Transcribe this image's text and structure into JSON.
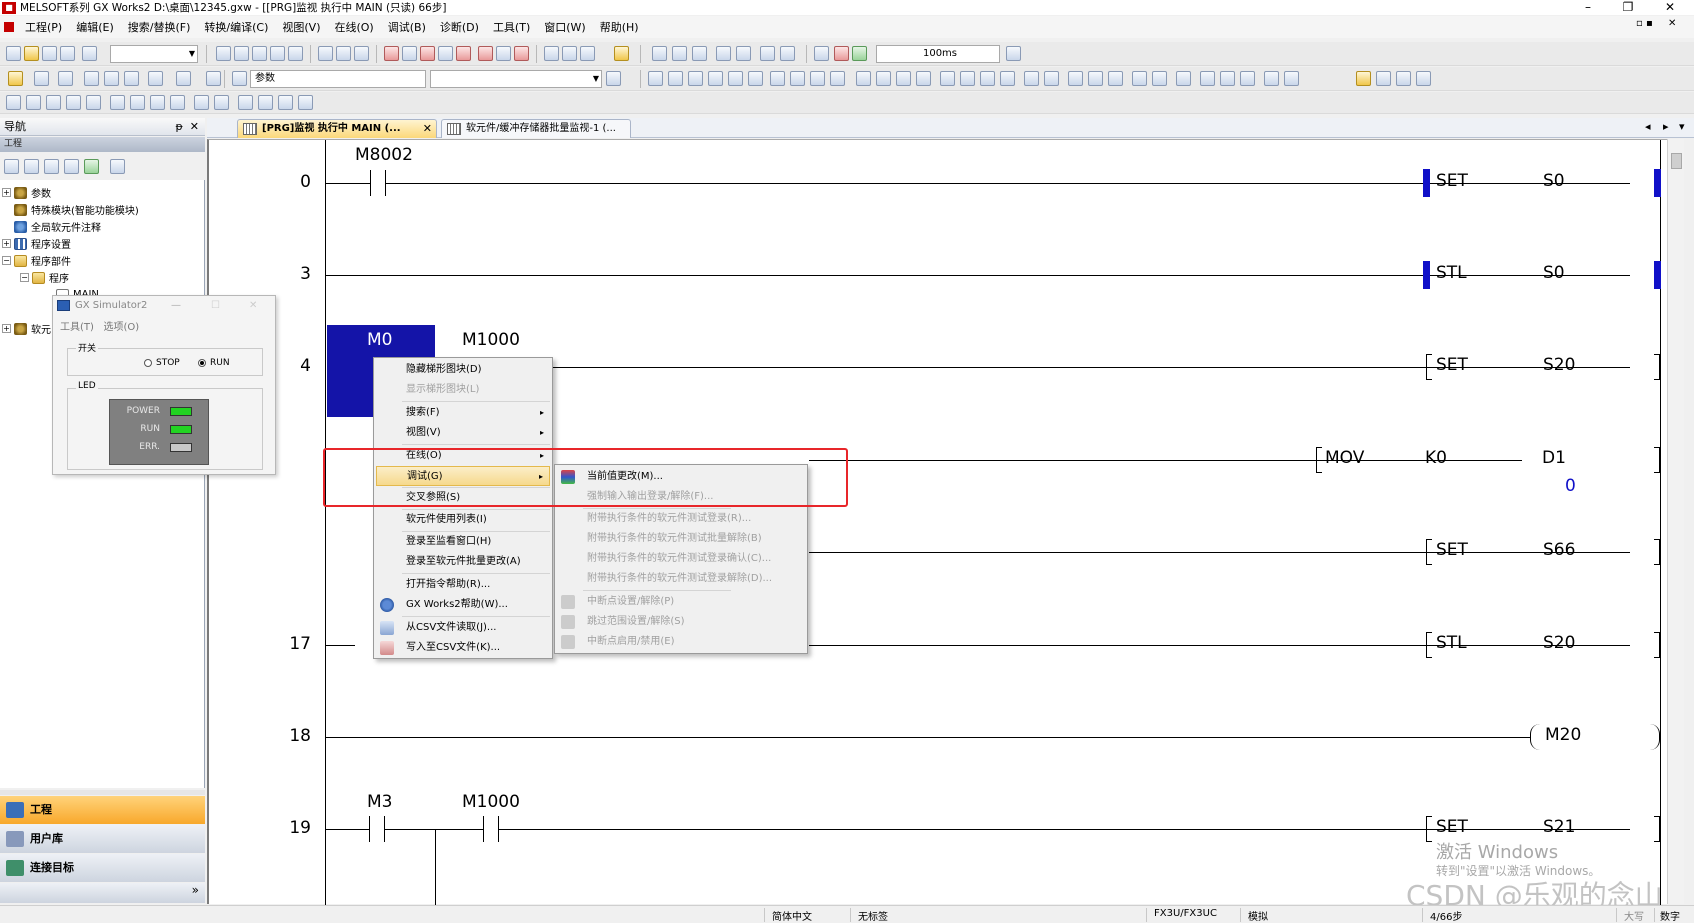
{
  "window": {
    "title": "MELSOFT系列 GX Works2 D:\\桌面\\12345.gxw - [[PRG]监视 执行中 MAIN (只读) 66步]",
    "minimize": "–",
    "restore": "❐",
    "close": "✕",
    "inner_restore": "▫ ▪",
    "inner_close": "✕"
  },
  "menubar": [
    "工程(P)",
    "编辑(E)",
    "搜索/替换(F)",
    "转换/编译(C)",
    "视图(V)",
    "在线(O)",
    "调试(B)",
    "诊断(D)",
    "工具(T)",
    "窗口(W)",
    "帮助(H)"
  ],
  "toolbar": {
    "scan_time": "100ms",
    "search_label": "参数"
  },
  "nav": {
    "title": "导航",
    "pin": "ᵽ",
    "close": "✕",
    "section": "工程",
    "tree": [
      {
        "label": "参数",
        "expander": "+"
      },
      {
        "label": "特殊模块(智能功能模块)",
        "expander": ""
      },
      {
        "label": "全局软元件注释",
        "expander": ""
      },
      {
        "label": "程序设置",
        "expander": "+"
      },
      {
        "label": "程序部件",
        "expander": "−"
      },
      {
        "label": "程序",
        "expander": "−"
      },
      {
        "label": "MAIN",
        "expander": ""
      },
      {
        "label": "软元",
        "expander": "+"
      }
    ],
    "buttons": [
      "工程",
      "用户库",
      "连接目标"
    ],
    "more": "»"
  },
  "simulator": {
    "title": "GX Simulator2",
    "min": "—",
    "max": "☐",
    "close": "✕",
    "menu": [
      "工具(T)",
      "选项(O)"
    ],
    "switch_group": "开关",
    "stop": "STOP",
    "run": "RUN",
    "led_group": "LED",
    "leds": [
      {
        "label": "POWER",
        "color": "#22d322"
      },
      {
        "label": "RUN",
        "color": "#22d322"
      },
      {
        "label": "ERR.",
        "color": "#c8c8c8"
      }
    ]
  },
  "tabs": [
    {
      "label": "[PRG]监视 执行中 MAIN (...",
      "close": "✕"
    },
    {
      "label": "软元件/缓冲存储器批量监视-1 (..."
    }
  ],
  "tab_nav": {
    "prev": "◂",
    "next": "▸",
    "menu": "▾"
  },
  "ladder": {
    "rungs": [
      {
        "step": "0",
        "contacts": [
          "M8002"
        ],
        "instr": "SET",
        "op": "S0"
      },
      {
        "step": "3",
        "contacts": [],
        "instr": "STL",
        "op": "S0"
      },
      {
        "step": "4",
        "contacts": [
          "M0",
          "M1000"
        ],
        "instr": "SET",
        "op": "S20"
      },
      {
        "step": "",
        "contacts": [],
        "instr": "MOV",
        "op1": "K0",
        "op2": "D1",
        "value": "0"
      },
      {
        "step": "",
        "contacts": [],
        "instr": "SET",
        "op": "S66"
      },
      {
        "step": "17",
        "contacts": [],
        "instr": "STL",
        "op": "S20"
      },
      {
        "step": "18",
        "contacts": [],
        "coil": "M20"
      },
      {
        "step": "19",
        "contacts": [
          "M3",
          "M1000"
        ],
        "instr": "SET",
        "op": "S21"
      }
    ]
  },
  "context_menu": {
    "items": [
      {
        "label": "隐藏梯形图块(D)",
        "disabled": false
      },
      {
        "label": "显示梯形图块(L)",
        "disabled": true
      },
      {
        "label": "搜索(F)",
        "submenu": true
      },
      {
        "label": "视图(V)",
        "submenu": true
      },
      {
        "label": "在线(O)",
        "submenu": true
      },
      {
        "label": "调试(G)",
        "submenu": true,
        "highlight": true
      },
      {
        "label": "交叉参照(S)"
      },
      {
        "label": "软元件使用列表(I)"
      },
      {
        "label": "登录至监看窗口(H)"
      },
      {
        "label": "登录至软元件批量更改(A)"
      },
      {
        "label": "打开指令帮助(R)..."
      },
      {
        "label": "GX Works2帮助(W)..."
      },
      {
        "label": "从CSV文件读取(J)..."
      },
      {
        "label": "写入至CSV文件(K)..."
      }
    ],
    "arrow": "▸"
  },
  "debug_submenu": [
    {
      "label": "当前值更改(M)...",
      "disabled": false
    },
    {
      "label": "强制输入输出登录/解除(F)...",
      "disabled": true
    },
    {
      "label": "附带执行条件的软元件测试登录(R)...",
      "disabled": true
    },
    {
      "label": "附带执行条件的软元件测试批量解除(B)",
      "disabled": true
    },
    {
      "label": "附带执行条件的软元件测试登录确认(C)...",
      "disabled": true
    },
    {
      "label": "附带执行条件的软元件测试登录解除(D)...",
      "disabled": true
    },
    {
      "label": "中断点设置/解除(P)",
      "disabled": true
    },
    {
      "label": "跳过范围设置/解除(S)",
      "disabled": true
    },
    {
      "label": "中断点启用/禁用(E)",
      "disabled": true
    }
  ],
  "status": {
    "lang": "简体中文",
    "title": "无标签",
    "plc": "FX3U/FX3UC",
    "mode": "模拟",
    "steps": "4/66步",
    "caps": "大写",
    "num": "数字"
  },
  "watermark": {
    "line1": "激活 Windows",
    "line2": "转到\"设置\"以激活 Windows。",
    "csdn": "CSDN @乐观的念山"
  }
}
